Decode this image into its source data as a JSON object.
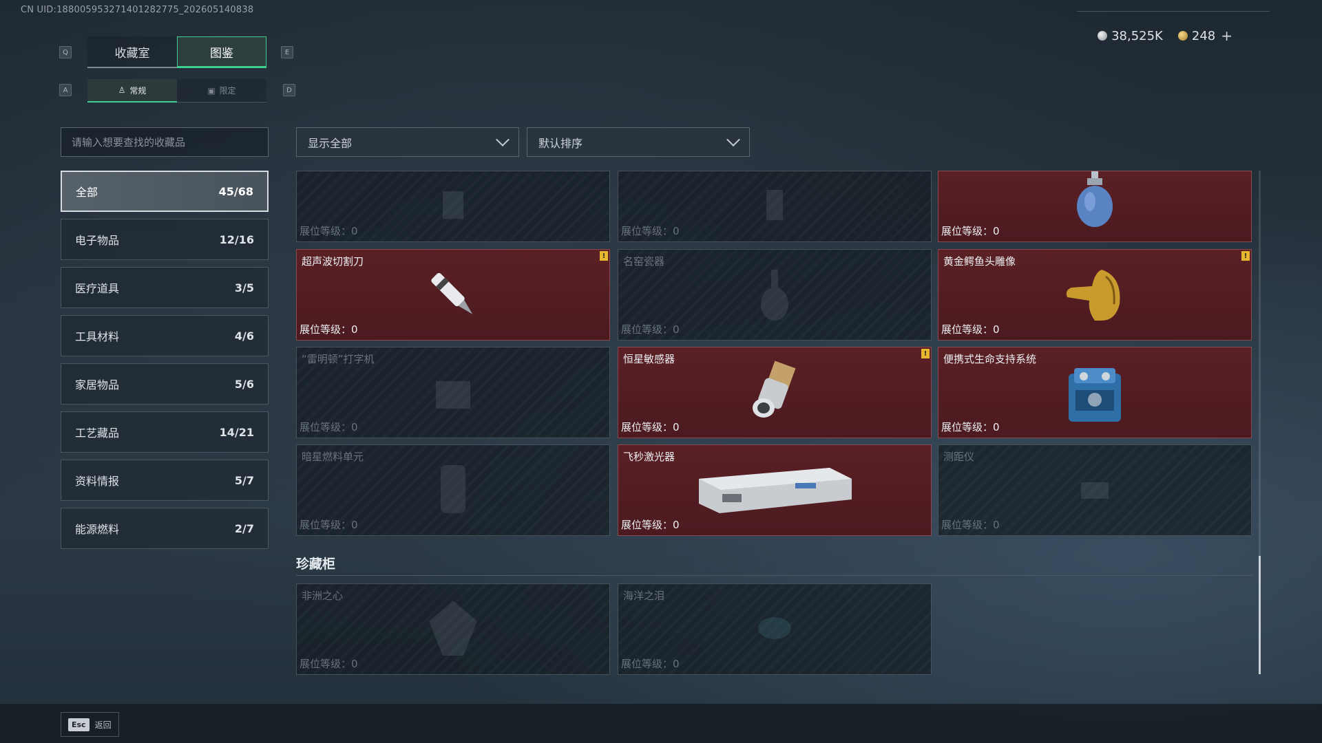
{
  "uid": "CN UID:1880059532714012827​75_202605140838",
  "currency": {
    "silver": "38,525K",
    "gold": "248",
    "add": "+"
  },
  "keys": {
    "q": "Q",
    "e": "E",
    "a": "A",
    "d": "D"
  },
  "tabs": [
    {
      "label": "收藏室"
    },
    {
      "label": "图鉴"
    }
  ],
  "subtabs": [
    {
      "label": "常规"
    },
    {
      "label": "限定"
    }
  ],
  "search": {
    "placeholder": "请输入想要查找的收藏品"
  },
  "filters": {
    "show": "显示全部",
    "sort": "默认排序"
  },
  "categories": [
    {
      "label": "全部",
      "count": "45/68"
    },
    {
      "label": "电子物品",
      "count": "12/16"
    },
    {
      "label": "医疗道具",
      "count": "3/5"
    },
    {
      "label": "工具材料",
      "count": "4/6"
    },
    {
      "label": "家居物品",
      "count": "5/6"
    },
    {
      "label": "工艺藏品",
      "count": "14/21"
    },
    {
      "label": "资料情报",
      "count": "5/7"
    },
    {
      "label": "能源燃料",
      "count": "2/7"
    }
  ],
  "level_label": "展位等级：",
  "cards": [
    {
      "name": "",
      "level": "0"
    },
    {
      "name": "",
      "level": "0"
    },
    {
      "name": "",
      "level": "0"
    },
    {
      "name": "超声波切割刀",
      "level": "0"
    },
    {
      "name": "名窑瓷器",
      "level": "0"
    },
    {
      "name": "黄金鳄鱼头雕像",
      "level": "0"
    },
    {
      "name": "“雷明顿”打字机",
      "level": "0"
    },
    {
      "name": "恒星敏感器",
      "level": "0"
    },
    {
      "name": "便携式生命支持系统",
      "level": "0"
    },
    {
      "name": "暗星燃料单元",
      "level": "0"
    },
    {
      "name": "飞秒激光器",
      "level": "0"
    },
    {
      "name": "测距仪",
      "level": "0"
    }
  ],
  "section": {
    "title": "珍藏柜"
  },
  "cabinet": [
    {
      "name": "非洲之心",
      "level": "0"
    },
    {
      "name": "海洋之泪",
      "level": "0"
    }
  ],
  "bottom": {
    "esc": "Esc",
    "back": "返回"
  }
}
